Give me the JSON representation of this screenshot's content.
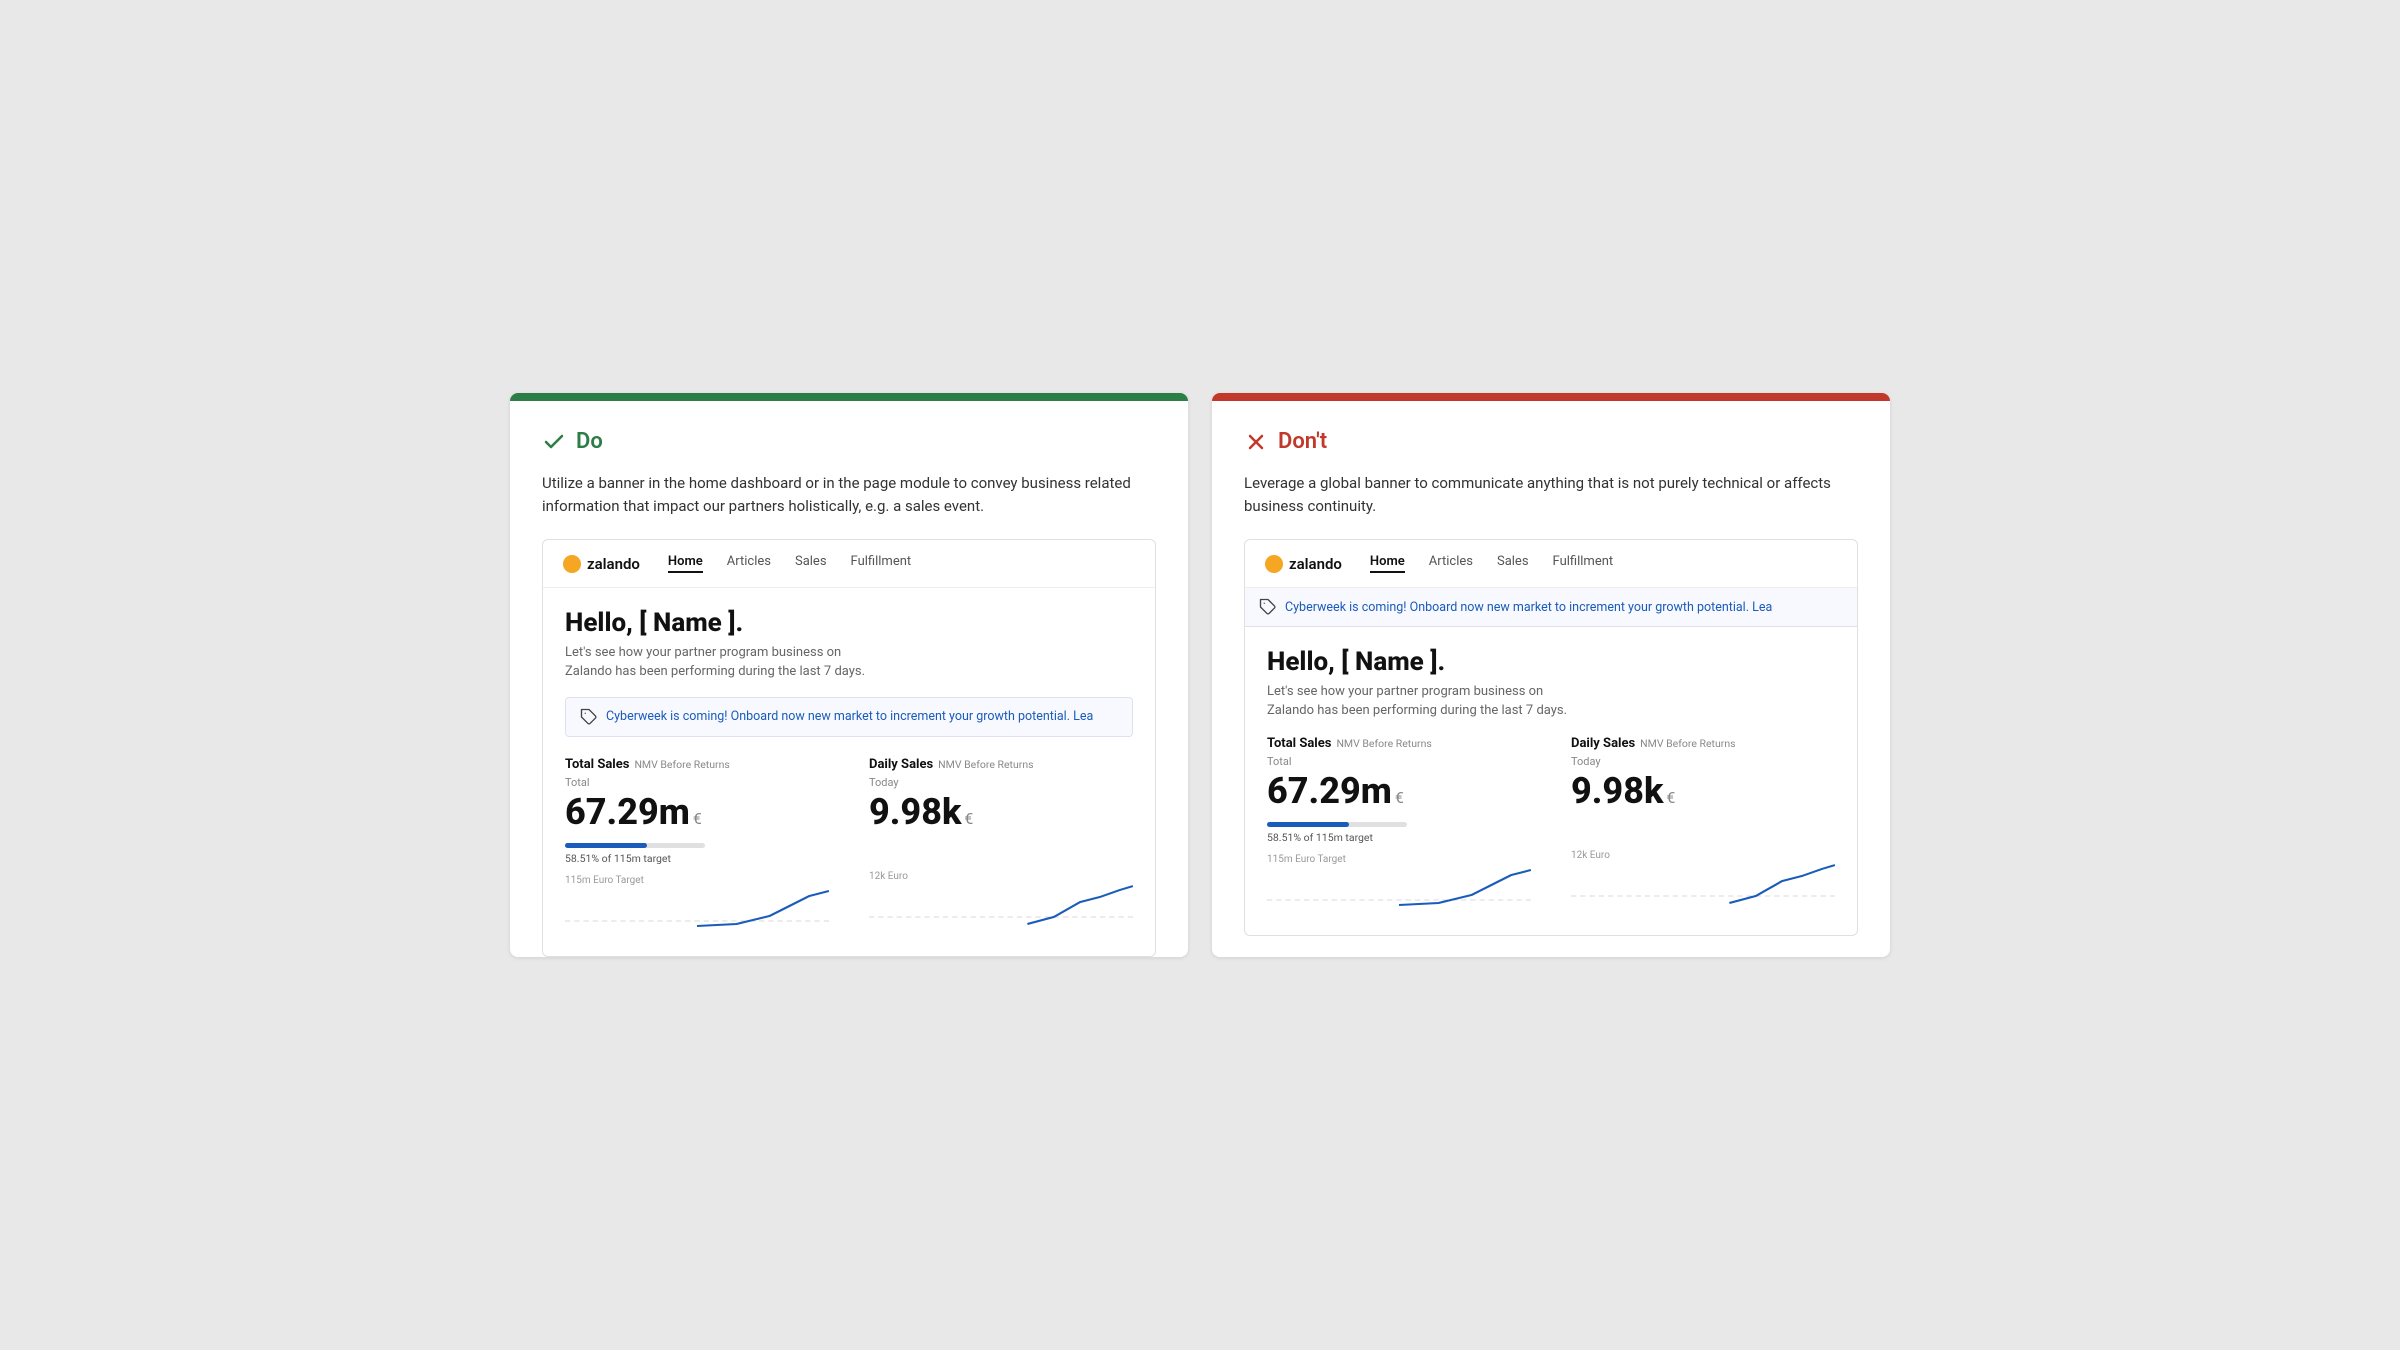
{
  "do_panel": {
    "bar_color": "green",
    "header_icon": "check",
    "title": "Do",
    "title_color": "green",
    "description": "Utilize a banner in the home dashboard or in the page module to convey business related information that impact our partners holistically, e.g. a sales event.",
    "dashboard": {
      "logo_text": "zalando",
      "nav_links": [
        "Home",
        "Articles",
        "Sales",
        "Fulfillment"
      ],
      "active_nav": "Home",
      "greeting": "Hello, [ Name ].",
      "subtext": "Let's see how your partner program business on\nZalando has been performing during the last 7 days.",
      "banner_text": "Cyberweek is coming! Onboard now new market to increment your growth potential. Lea",
      "total_sales_label": "Total Sales",
      "total_sales_sub": "NMV Before Returns",
      "daily_sales_label": "Daily Sales",
      "daily_sales_sub": "NMV Before Returns",
      "total_period": "Total",
      "today_period": "Today",
      "total_value": "67.29m",
      "total_unit": "€",
      "daily_value": "9.98k",
      "daily_unit": "€",
      "progress_percent": "58.51%",
      "progress_label": "58.51% of 115m target",
      "chart_meta_total": "115m  Euro  Target",
      "chart_meta_daily": "12k  Euro"
    }
  },
  "dont_panel": {
    "bar_color": "red",
    "header_icon": "x",
    "title": "Don't",
    "title_color": "red",
    "description": "Leverage a global banner to communicate anything that is not purely technical or affects business continuity.",
    "dashboard": {
      "logo_text": "zalando",
      "nav_links": [
        "Home",
        "Articles",
        "Sales",
        "Fulfillment"
      ],
      "active_nav": "Home",
      "banner_text": "Cyberweek is coming! Onboard now new market to increment your growth potential. Lea",
      "greeting": "Hello, [ Name ].",
      "subtext": "Let's see how your partner program business on\nZalando has been performing during the last 7 days.",
      "total_sales_label": "Total Sales",
      "total_sales_sub": "NMV Before Returns",
      "daily_sales_label": "Daily Sales",
      "daily_sales_sub": "NMV Before Returns",
      "total_period": "Total",
      "today_period": "Today",
      "total_value": "67.29m",
      "total_unit": "€",
      "daily_value": "9.98k",
      "daily_unit": "€",
      "progress_percent": "58.51%",
      "progress_label": "58.51% of 115m target",
      "chart_meta_total": "115m  Euro  Target",
      "chart_meta_daily": "12k  Euro"
    }
  }
}
